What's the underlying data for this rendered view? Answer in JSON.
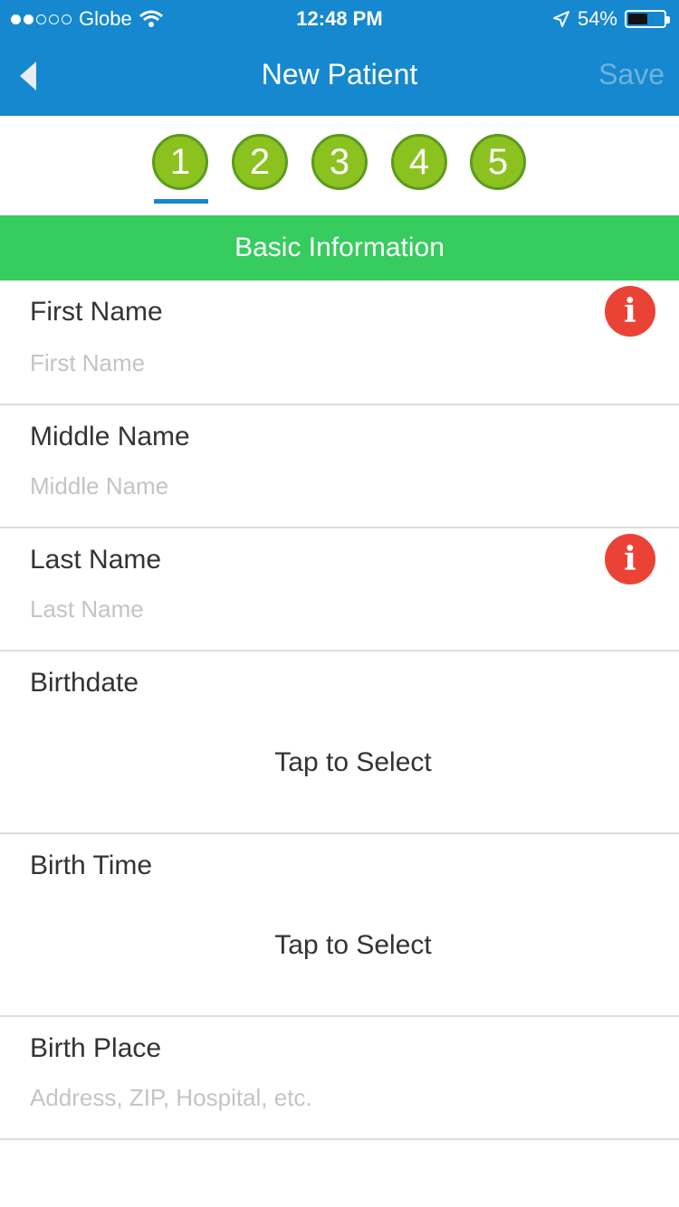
{
  "status": {
    "carrier": "Globe",
    "time": "12:48 PM",
    "battery": "54%",
    "battery_level": 0.54
  },
  "nav": {
    "title": "New Patient",
    "save_label": "Save"
  },
  "steps": [
    "1",
    "2",
    "3",
    "4",
    "5"
  ],
  "active_step": "1",
  "section": "Basic Information",
  "fields": {
    "first_name": {
      "label": "First Name",
      "placeholder": "First Name"
    },
    "middle_name": {
      "label": "Middle Name",
      "placeholder": "Middle Name"
    },
    "last_name": {
      "label": "Last Name",
      "placeholder": "Last Name"
    },
    "birthdate": {
      "label": "Birthdate",
      "value": "Tap to Select"
    },
    "birth_time": {
      "label": "Birth Time",
      "value": "Tap to Select"
    },
    "birth_place": {
      "label": "Birth Place",
      "placeholder": "Address, ZIP, Hospital, etc."
    }
  },
  "icons": {
    "required": "info-icon",
    "back": "chevron-left-icon"
  },
  "colors": {
    "nav": "#1588cf",
    "section": "#36cc5e",
    "step": "#8cc21f",
    "required": "#ea4335"
  }
}
